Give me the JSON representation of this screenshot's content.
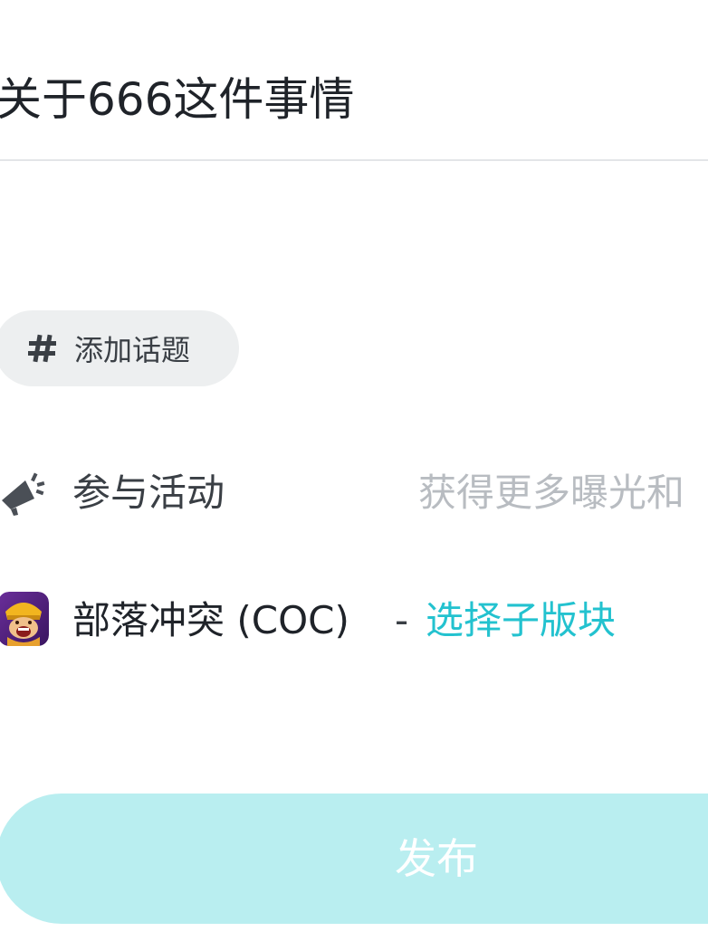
{
  "post": {
    "title_value": "关于666这件事情"
  },
  "topic": {
    "icon": "hash-icon",
    "label": "添加话题"
  },
  "activity": {
    "icon": "megaphone-icon",
    "label": "参与活动",
    "hint": "获得更多曝光和"
  },
  "forum": {
    "icon": "clash-of-clans-icon",
    "game_name": "部落冲突 (COC)",
    "separator": "-",
    "choose_label": "选择子版块",
    "link_color": "#23c2cf"
  },
  "publish": {
    "label": "发布",
    "bg_color": "#b9eef0"
  }
}
